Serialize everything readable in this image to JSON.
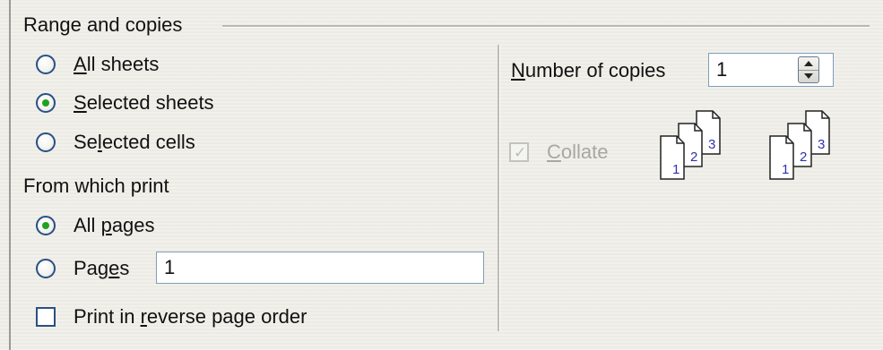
{
  "range_group": {
    "title": "Range and copies",
    "options": [
      {
        "label_before": "",
        "mnemonic": "A",
        "label_after": "ll sheets",
        "checked": false
      },
      {
        "label_before": "",
        "mnemonic": "S",
        "label_after": "elected sheets",
        "checked": true
      },
      {
        "label_before": "Se",
        "mnemonic": "l",
        "label_after": "ected cells",
        "checked": false
      }
    ]
  },
  "print_group": {
    "title": "From which print",
    "all_pages": {
      "label_before": "All ",
      "mnemonic": "p",
      "label_after": "ages",
      "checked": true
    },
    "pages": {
      "label_before": "Pag",
      "mnemonic": "e",
      "label_after": "s",
      "checked": false,
      "value": "1"
    },
    "reverse": {
      "label_before": "Print in ",
      "mnemonic": "r",
      "label_after": "everse page order",
      "checked": false
    }
  },
  "copies": {
    "label_before": "",
    "mnemonic": "N",
    "label_after": "umber of copies",
    "value": "1"
  },
  "collate": {
    "label_before": "",
    "mnemonic": "C",
    "label_after": "ollate",
    "checked": true,
    "disabled": true
  },
  "collate_icons": [
    {
      "pages": [
        "1",
        "2",
        "3"
      ]
    },
    {
      "pages": [
        "1",
        "2",
        "3"
      ]
    }
  ],
  "colors": {
    "radio_dot": "#21a121",
    "control_border": "#2a4f86",
    "page_number": "#3030b0",
    "disabled_text": "#a8a8a2"
  }
}
